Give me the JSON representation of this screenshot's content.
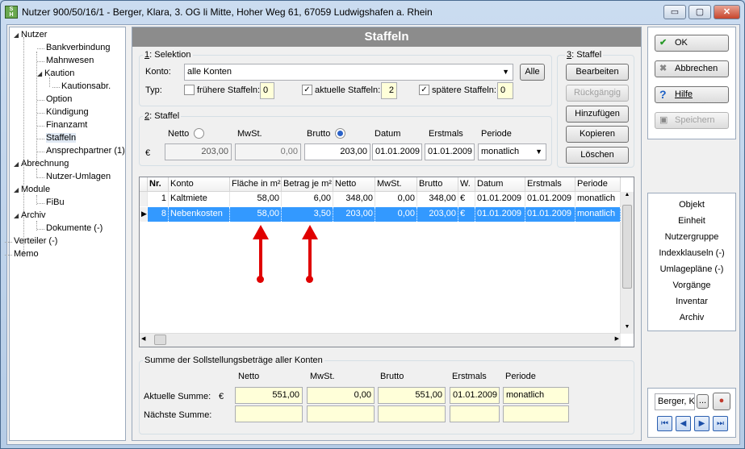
{
  "window": {
    "title": "Nutzer 900/50/16/1 - Berger, Klara, 3. OG li Mitte, Hoher Weg 61, 67059 Ludwigshafen a. Rhein",
    "min": "▭",
    "max": "▢",
    "close": "✕"
  },
  "tree": {
    "items": [
      "Nutzer",
      "Bankverbindung",
      "Mahnwesen",
      "Kaution",
      "Kautionsabr.",
      "Option",
      "Kündigung",
      "Finanzamt",
      "Staffeln",
      "Ansprechpartner (1)",
      "Abrechnung",
      "Nutzer-Umlagen",
      "Module",
      "FiBu",
      "Archiv",
      "Dokumente (-)",
      "Verteiler (-)",
      "Memo"
    ]
  },
  "header": {
    "title": "Staffeln"
  },
  "selektion": {
    "group_num": "1",
    "group_label": ": Selektion",
    "konto_label": "Konto:",
    "konto_value": "alle Konten",
    "alle_btn": "Alle",
    "typ_label": "Typ:",
    "fruehere_label": "frühere Staffeln:",
    "fruehere_count": "0",
    "aktuelle_label": "aktuelle Staffeln:",
    "aktuelle_count": "2",
    "spaetere_label": "spätere Staffeln:",
    "spaetere_count": "0"
  },
  "staffel_actions": {
    "group_num": "3",
    "group_label": ": Staffel",
    "bearbeiten": "Bearbeiten",
    "rueckgaengig": "Rückgängig",
    "hinzufuegen": "Hinzufügen",
    "kopieren": "Kopieren",
    "loeschen": "Löschen"
  },
  "staffel": {
    "group_num": "2",
    "group_label": ": Staffel",
    "netto_label": "Netto",
    "mwst_label": "MwSt.",
    "brutto_label": "Brutto",
    "datum_label": "Datum",
    "erstmals_label": "Erstmals",
    "periode_label": "Periode",
    "currency": "€",
    "netto": "203,00",
    "mwst": "0,00",
    "brutto": "203,00",
    "datum": "01.01.2009",
    "erstmals": "01.01.2009",
    "periode": "monatlich",
    "selected_radio": "Brutto"
  },
  "grid": {
    "columns": [
      "Nr.",
      "Konto",
      "Fläche in m²",
      "Betrag je m²",
      "Netto",
      "MwSt.",
      "Brutto",
      "W.",
      "Datum",
      "Erstmals",
      "Periode"
    ],
    "rows": [
      [
        "1",
        "Kaltmiete",
        "58,00",
        "6,00",
        "348,00",
        "0,00",
        "348,00",
        "€",
        "01.01.2009",
        "01.01.2009",
        "monatlich"
      ],
      [
        "8",
        "Nebenkosten",
        "58,00",
        "3,50",
        "203,00",
        "0,00",
        "203,00",
        "€",
        "01.01.2009",
        "01.01.2009",
        "monatlich"
      ]
    ],
    "selected_row": 1
  },
  "summe": {
    "group_label": "Summe der Sollstellungsbeträge aller Konten",
    "netto_label": "Netto",
    "mwst_label": "MwSt.",
    "brutto_label": "Brutto",
    "erstmals_label": "Erstmals",
    "periode_label": "Periode",
    "aktuelle_label": "Aktuelle Summe:",
    "currency": "€",
    "naechste_label": "Nächste Summe:",
    "netto": "551,00",
    "mwst": "0,00",
    "brutto": "551,00",
    "erstmals": "01.01.2009",
    "periode": "monatlich"
  },
  "actions": {
    "ok": "OK",
    "abbrechen": "Abbrechen",
    "hilfe": "Hilfe",
    "speichern": "Speichern"
  },
  "links": [
    "Objekt",
    "Einheit",
    "Nutzergruppe",
    "Indexklauseln (-)",
    "Umlagepläne (-)",
    "Vorgänge",
    "Inventar",
    "Archiv"
  ],
  "nav": {
    "name": "Berger, K",
    "more": "..."
  },
  "colors": {
    "accent": "#3399ff",
    "header_bg": "#8c8c8c",
    "annotation": "#e00000"
  }
}
